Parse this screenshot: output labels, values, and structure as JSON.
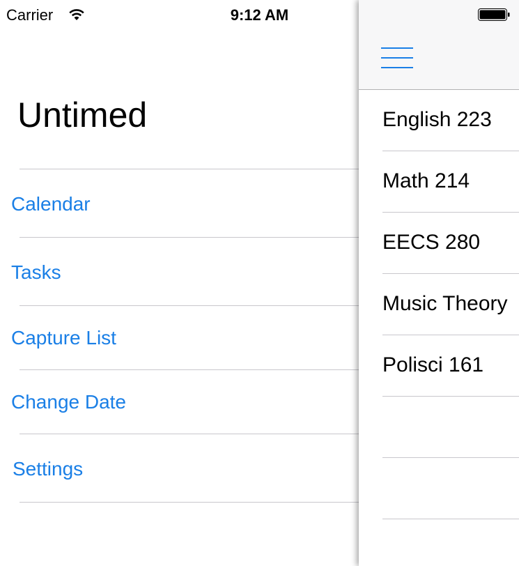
{
  "status_bar": {
    "carrier": "Carrier",
    "time": "9:12 AM",
    "icons": [
      "wifi-icon",
      "battery-icon"
    ]
  },
  "menu": {
    "title": "Untimed",
    "items": [
      {
        "label": "Calendar"
      },
      {
        "label": "Tasks"
      },
      {
        "label": "Capture List"
      },
      {
        "label": "Change Date"
      },
      {
        "label": "Settings"
      }
    ]
  },
  "panel": {
    "nav_icon": "hamburger-menu-icon",
    "classes": [
      {
        "label": "English 223"
      },
      {
        "label": "Math 214"
      },
      {
        "label": "EECS 280"
      },
      {
        "label": "Music Theory"
      },
      {
        "label": "Polisci 161"
      }
    ]
  },
  "colors": {
    "accent": "#1a7fe6",
    "divider": "#c8c7cc",
    "navbar_bg": "#f7f7f8"
  }
}
